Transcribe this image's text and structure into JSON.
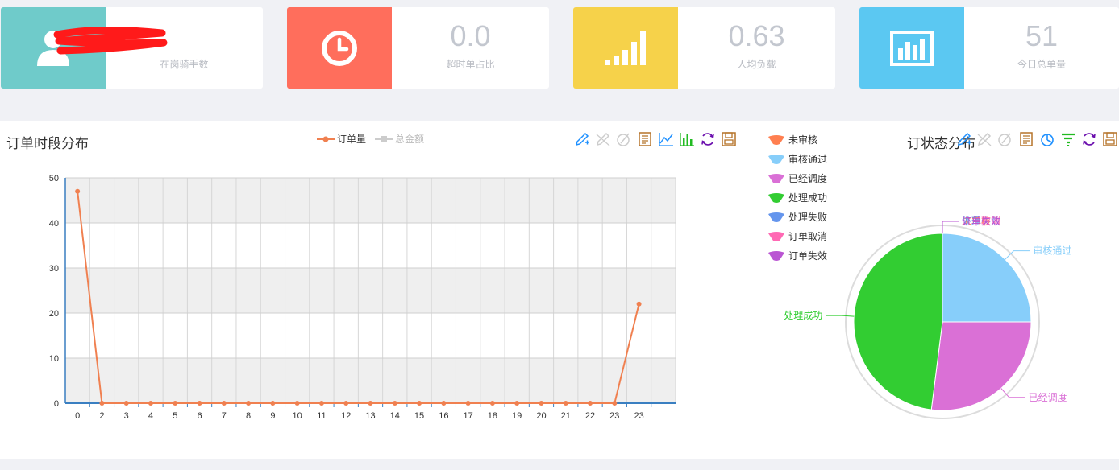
{
  "cards": [
    {
      "value": "",
      "label": "在岗骑手数",
      "color": "#6fcbca",
      "icon": "user-icon"
    },
    {
      "value": "0.0",
      "label": "超时单占比",
      "color": "#ff6e5c",
      "icon": "clock-icon"
    },
    {
      "value": "0.63",
      "label": "人均负载",
      "color": "#f6d24a",
      "icon": "signal-icon"
    },
    {
      "value": "51",
      "label": "今日总单量",
      "color": "#5bc8f2",
      "icon": "bar-chart-icon"
    }
  ],
  "line_panel": {
    "title": "订单时段分布",
    "legend": [
      {
        "name": "订单量",
        "color": "#f08050",
        "active": true
      },
      {
        "name": "总金额",
        "color": "#cccccc",
        "active": false
      }
    ],
    "tools": [
      "mark-icon",
      "mark-undo-icon",
      "mark-clear-icon",
      "data-view-icon",
      "line-chart-icon",
      "bar-chart-toggle-icon",
      "refresh-icon",
      "save-image-icon"
    ]
  },
  "pie_panel": {
    "title": "订状态分布",
    "legend": [
      {
        "name": "未审核",
        "color": "#ff7f50"
      },
      {
        "name": "审核通过",
        "color": "#87cefa"
      },
      {
        "name": "已经调度",
        "color": "#da70d6"
      },
      {
        "name": "处理成功",
        "color": "#32cd32"
      },
      {
        "name": "处理失败",
        "color": "#6495ed"
      },
      {
        "name": "订单取消",
        "color": "#ff69b4"
      },
      {
        "name": "订单失效",
        "color": "#ba55d3"
      }
    ],
    "tools": [
      "mark-icon",
      "mark-undo-icon",
      "mark-clear-icon",
      "data-view-icon",
      "pie-icon",
      "funnel-icon",
      "refresh-icon",
      "save-image-icon"
    ],
    "overlap_labels": [
      "过程失败",
      "订单取消"
    ]
  },
  "chart_data": [
    {
      "type": "line",
      "title": "订单时段分布",
      "x_tick_labels": [
        "0",
        "2",
        "3",
        "4",
        "5",
        "6",
        "7",
        "8",
        "9",
        "10",
        "11",
        "12",
        "13",
        "14",
        "15",
        "16",
        "17",
        "18",
        "19",
        "20",
        "21",
        "22",
        "23",
        "23"
      ],
      "series": [
        {
          "name": "订单量",
          "color": "#f08050",
          "values": [
            47,
            0,
            0,
            0,
            0,
            0,
            0,
            0,
            0,
            0,
            0,
            0,
            0,
            0,
            0,
            0,
            0,
            0,
            0,
            0,
            0,
            0,
            0,
            22
          ]
        }
      ],
      "ylim": [
        0,
        50
      ],
      "y_ticks": [
        0,
        10,
        20,
        30,
        40,
        50
      ],
      "grid": true,
      "legend_position": "top-center"
    },
    {
      "type": "pie",
      "title": "订状态分布",
      "slices": [
        {
          "name": "未审核",
          "value": 0,
          "color": "#ff7f50"
        },
        {
          "name": "审核通过",
          "value": 25,
          "color": "#87cefa"
        },
        {
          "name": "已经调度",
          "value": 27,
          "color": "#da70d6"
        },
        {
          "name": "处理成功",
          "value": 48,
          "color": "#32cd32"
        },
        {
          "name": "处理失败",
          "value": 0,
          "color": "#6495ed"
        },
        {
          "name": "订单取消",
          "value": 0,
          "color": "#ff69b4"
        },
        {
          "name": "订单失效",
          "value": 0,
          "color": "#ba55d3"
        }
      ],
      "legend_position": "top-left"
    }
  ]
}
